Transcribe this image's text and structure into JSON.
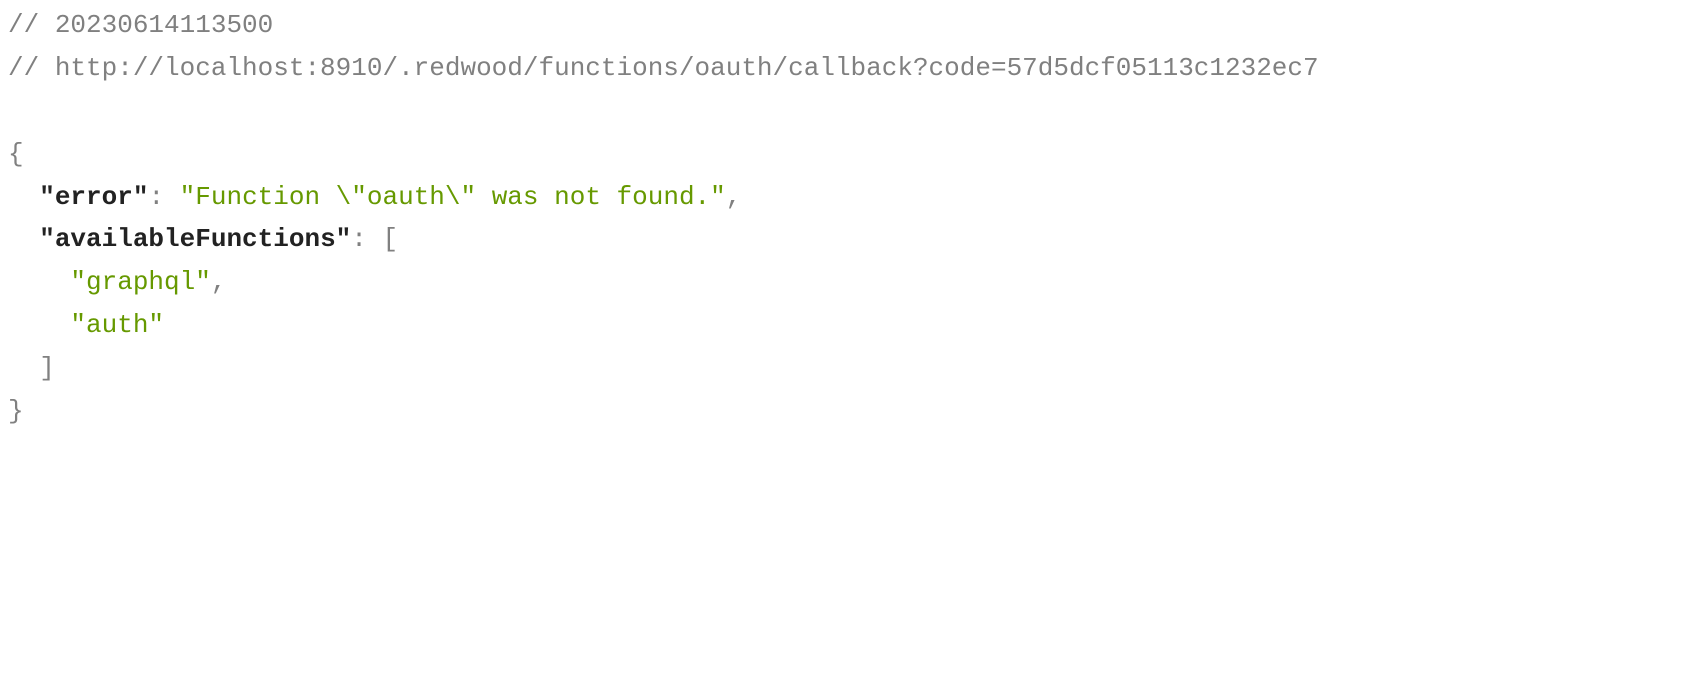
{
  "comments": {
    "timestamp": "20230614113500",
    "url": "http://localhost:8910/.redwood/functions/oauth/callback?code=57d5dcf05113c1232ec7"
  },
  "json": {
    "error_key": "error",
    "error_value": "Function \\\"oauth\\\" was not found.",
    "available_key": "availableFunctions",
    "available_values": [
      "graphql",
      "auth"
    ]
  },
  "tokens": {
    "comment_prefix": "// ",
    "open_brace": "{",
    "close_brace": "}",
    "open_bracket": "[",
    "close_bracket": "]",
    "colon": ": ",
    "comma": ",",
    "quote": "\""
  }
}
